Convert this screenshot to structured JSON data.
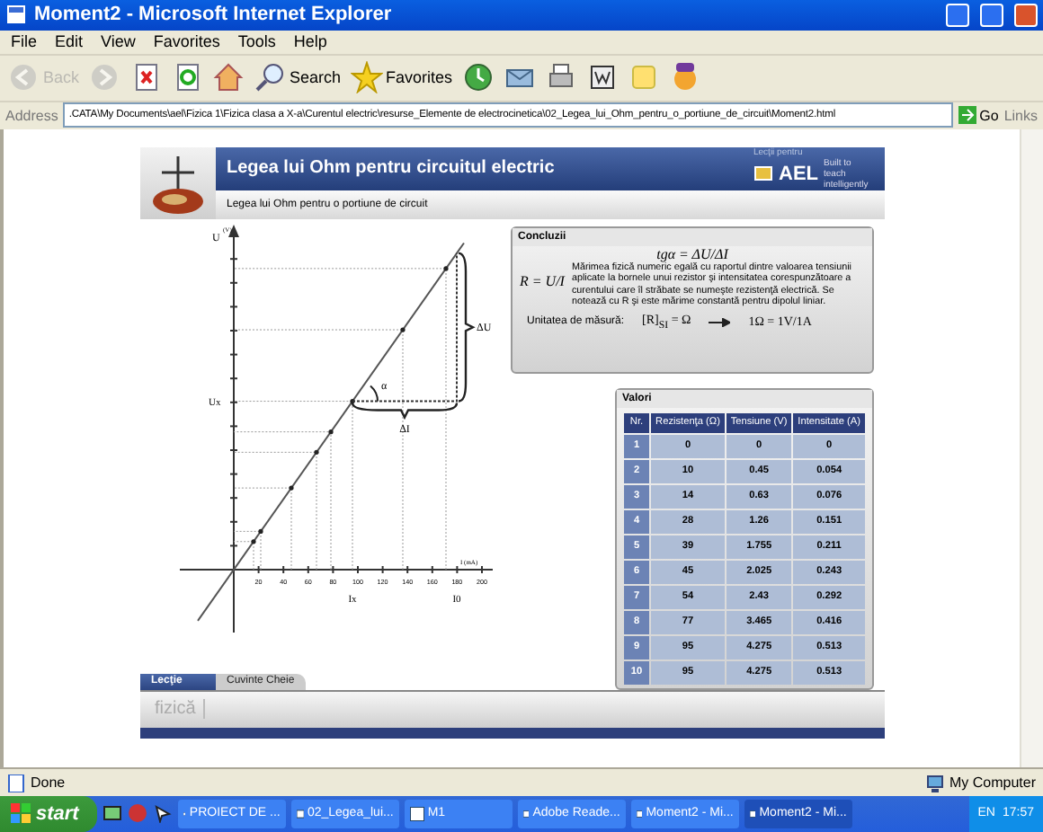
{
  "window": {
    "title": "Moment2 - Microsoft Internet Explorer"
  },
  "menu": [
    "File",
    "Edit",
    "View",
    "Favorites",
    "Tools",
    "Help"
  ],
  "toolbar": [
    {
      "kind": "back",
      "label": "Back",
      "disabled": true
    },
    {
      "kind": "forward",
      "disabled": true
    },
    {
      "kind": "stop"
    },
    {
      "kind": "refresh"
    },
    {
      "kind": "home"
    },
    {
      "kind": "search",
      "label": "Search"
    },
    {
      "kind": "favorites",
      "label": "Favorites"
    },
    {
      "kind": "history"
    },
    {
      "kind": "mail"
    },
    {
      "kind": "print"
    },
    {
      "kind": "word"
    },
    {
      "kind": "note"
    },
    {
      "kind": "messenger"
    }
  ],
  "address": {
    "label": "Address",
    "value": ".CATA\\My Documents\\ael\\Fizica 1\\Fizica clasa a X-a\\Curentul electric\\resurse_Elemente de electrocinetica\\02_Legea_lui_Ohm_pentru_o_portiune_de_circuit\\Moment2.html",
    "go": "Go",
    "links": "Links"
  },
  "lesson": {
    "title": "Legea lui Ohm pentru circuitul electric",
    "subtitle": "Legea lui Ohm pentru o portiune de circuit",
    "brand_top": "Lecţii pentru",
    "brand": "AEL",
    "brand_tagline": "Built to teach intelligently",
    "diagram": {
      "y_axis": "U",
      "y_unit": "(V)",
      "x_unit": "I (mA)",
      "x_ticks": [
        "20",
        "40",
        "60",
        "80",
        "100",
        "120",
        "140",
        "160",
        "180",
        "200"
      ],
      "ux": "Ux",
      "ix": "Ix",
      "i0": "I0",
      "delta_u": "ΔU",
      "delta_i": "ΔI",
      "angle": "α"
    },
    "conclusions": {
      "title": "Concluzii",
      "formula_tg": "tgα = ΔU/ΔI",
      "formula_r": "R = U/I",
      "text": "Mărimea fizică numeric egală cu raportul dintre valoarea tensiunii aplicate la bornele unui rezistor şi intensitatea corespunzătoare a curentului care îl străbate se numeşte rezistenţă electrică. Se notează cu R şi este mărime constantă pentru dipolul liniar.",
      "unit_label": "Unitatea de măsură:",
      "unit_si": "[R]$_{SI}$ = Ω",
      "unit_def": "1Ω = 1V/1A"
    },
    "values": {
      "title": "Valori",
      "columns": [
        "Nr.",
        "Rezistenţa (Ω)",
        "Tensiune (V)",
        "Intensitate (A)"
      ],
      "rows": [
        [
          "1",
          "0",
          "0",
          "0"
        ],
        [
          "2",
          "10",
          "0.45",
          "0.054"
        ],
        [
          "3",
          "14",
          "0.63",
          "0.076"
        ],
        [
          "4",
          "28",
          "1.26",
          "0.151"
        ],
        [
          "5",
          "39",
          "1.755",
          "0.211"
        ],
        [
          "6",
          "45",
          "2.025",
          "0.243"
        ],
        [
          "7",
          "54",
          "2.43",
          "0.292"
        ],
        [
          "8",
          "77",
          "3.465",
          "0.416"
        ],
        [
          "9",
          "95",
          "4.275",
          "0.513"
        ],
        [
          "10",
          "95",
          "4.275",
          "0.513"
        ]
      ]
    },
    "tabs": [
      {
        "label": "Lecţie",
        "selected": true
      },
      {
        "label": "Cuvinte Cheie",
        "selected": false
      }
    ],
    "footer": "fizică"
  },
  "status_bar": {
    "text": "Done",
    "zone": "My Computer"
  },
  "taskbar": {
    "start": "start",
    "tasks": [
      {
        "label": "PROIECT DE ...",
        "selected": false
      },
      {
        "label": "02_Legea_lui...",
        "selected": false
      },
      {
        "label": "M1",
        "selected": false
      },
      {
        "label": "Adobe Reade...",
        "selected": false
      },
      {
        "label": "Moment2 - Mi...",
        "selected": false
      },
      {
        "label": "Moment2 - Mi...",
        "selected": true
      }
    ],
    "language": "EN",
    "clock": "17:57"
  }
}
